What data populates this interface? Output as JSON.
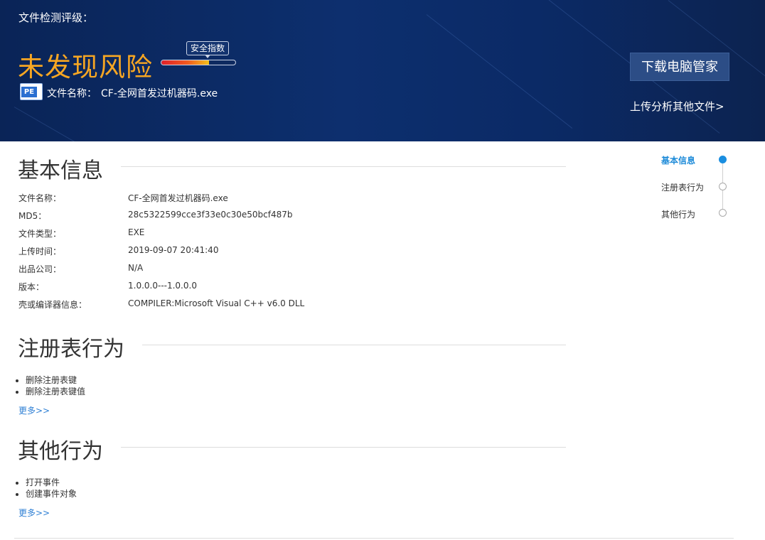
{
  "header": {
    "rating_label": "文件检测评级：",
    "verdict": "未发现风险",
    "safety_index_label": "安全指数",
    "safety_index_fill_percent": 64,
    "file_icon_label": "PE",
    "file_name_label": "文件名称：",
    "file_name": "CF-全网首发过机器码.exe",
    "download_button": "下载电脑管家",
    "upload_link": "上传分析其他文件>"
  },
  "basic_info": {
    "title": "基本信息",
    "rows": [
      {
        "key": "文件名称：",
        "value": "CF-全网首发过机器码.exe"
      },
      {
        "key": "MD5：",
        "value": "28c5322599cce3f33e0c30e50bcf487b"
      },
      {
        "key": "文件类型：",
        "value": "EXE"
      },
      {
        "key": "上传时间：",
        "value": "2019-09-07 20:41:40"
      },
      {
        "key": "出品公司：",
        "value": "N/A"
      },
      {
        "key": "版本：",
        "value": "1.0.0.0---1.0.0.0"
      },
      {
        "key": "壳或编译器信息：",
        "value": "COMPILER:Microsoft Visual C++ v6.0 DLL"
      }
    ]
  },
  "registry": {
    "title": "注册表行为",
    "items": [
      "删除注册表键",
      "删除注册表键值"
    ],
    "more": "更多>>"
  },
  "other": {
    "title": "其他行为",
    "items": [
      "打开事件",
      "创建事件对象"
    ],
    "more": "更多>>"
  },
  "side_nav": {
    "items": [
      "基本信息",
      "注册表行为",
      "其他行为"
    ],
    "active_index": 0
  },
  "colors": {
    "banner": "#0d2f6e",
    "verdict": "#f6a623",
    "accent": "#1a8ee0",
    "link": "#2e7fd4"
  }
}
